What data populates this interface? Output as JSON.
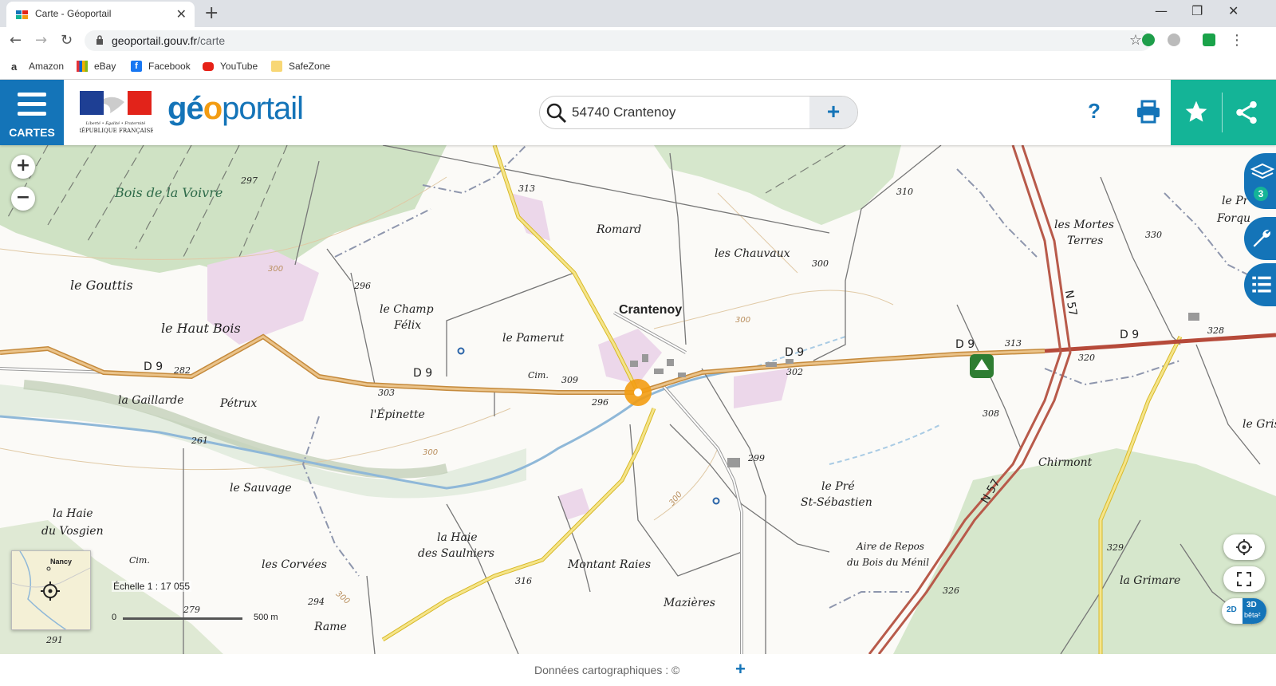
{
  "browser": {
    "tab_title": "Carte - Géoportail",
    "tab_close": "✕",
    "new_tab": "+",
    "window_controls": [
      "—",
      "❐",
      "✕"
    ],
    "url_host": "geoportail.gouv.fr",
    "url_path": "/carte",
    "bookmarks": [
      {
        "label": "Amazon",
        "icon": "amazon-icon"
      },
      {
        "label": "eBay",
        "icon": "ebay-icon"
      },
      {
        "label": "Facebook",
        "icon": "facebook-icon"
      },
      {
        "label": "YouTube",
        "icon": "youtube-icon"
      },
      {
        "label": "SafeZone",
        "icon": "folder-icon"
      }
    ]
  },
  "header": {
    "menu_label": "CARTES",
    "marianne_text": "RÉPUBLIQUE FRANÇAISE",
    "marianne_motto": "Liberté • Égalité • Fraternité",
    "logo_part1": "gé",
    "logo_part2": "o",
    "logo_part3": "portail",
    "search_value": "54740 Crantenoy",
    "search_plus": "+",
    "help_label": "?",
    "colors": {
      "primary": "#1474b8",
      "accent": "#14b497",
      "logo_orange": "#f39c12"
    }
  },
  "map": {
    "places": {
      "bois_voivre": "Bois de la Voivre",
      "gouttis": "le Gouttis",
      "haut_bois": "le Haut Bois",
      "champ_felix_1": "le Champ",
      "champ_felix_2": "Félix",
      "pamerut": "le Pamerut",
      "romard": "Romard",
      "chauvaux": "les Chauvaux",
      "crantenoy": "Crantenoy",
      "mortes_terres_1": "les Mortes",
      "mortes_terres_2": "Terres",
      "le_pr": "le Pr",
      "forqu": "Forqu",
      "gaillarde": "la Gaillarde",
      "petrux": "Pétrux",
      "epinette": "l'Épinette",
      "sauvage": "le Sauvage",
      "haie_vosgien_1": "la Haie",
      "haie_vosgien_2": "du Vosgien",
      "haie_saulniers_1": "la Haie",
      "haie_saulniers_2": "des Saulniers",
      "montant_raies": "Montant Raies",
      "mazieres": "Mazières",
      "corvees": "les Corvées",
      "rame": "Rame",
      "pre_sebastien_1": "le Pré",
      "pre_sebastien_2": "St-Sébastien",
      "aire_repos_1": "Aire de Repos",
      "aire_repos_2": "du Bois du Ménil",
      "chirmont": "Chirmont",
      "grimare": "la Grimare",
      "le_gris": "le Gris",
      "cim1": "Cim.",
      "cim2": "Cim."
    },
    "roads": {
      "d9_a": "D 9",
      "d9_b": "D 9",
      "d9_c": "D 9",
      "d9_d": "D 9",
      "d9_e": "D 9",
      "n57_a": "N 57",
      "n57_b": "N 57"
    },
    "elevations": {
      "e297": "297",
      "e313": "313",
      "e310": "310",
      "e330": "330",
      "e300a": "300",
      "e296a": "296",
      "e282": "282",
      "e303": "303",
      "e309": "309",
      "e296b": "296",
      "e302": "302",
      "e313b": "313",
      "e320": "320",
      "e328": "328",
      "e261": "261",
      "e299": "299",
      "e308": "308",
      "e316": "316",
      "e294": "294",
      "e326": "326",
      "e329": "329",
      "e279": "279",
      "e291": "291"
    },
    "contours": {
      "c1": "300",
      "c2": "300",
      "c3": "300",
      "c4": "300",
      "c5": "300"
    },
    "zoom_in": "+",
    "zoom_out": "−",
    "layers_count": "3",
    "minimap_city": "Nancy",
    "scale_label": "Échelle 1 : 17 055",
    "scale_start": "0",
    "scale_end": "500 m",
    "mode_2d": "2D",
    "mode_3d": "3D",
    "mode_beta": "bêta²"
  },
  "footer": {
    "credits": "Données cartographiques : ©",
    "plus": "+"
  }
}
